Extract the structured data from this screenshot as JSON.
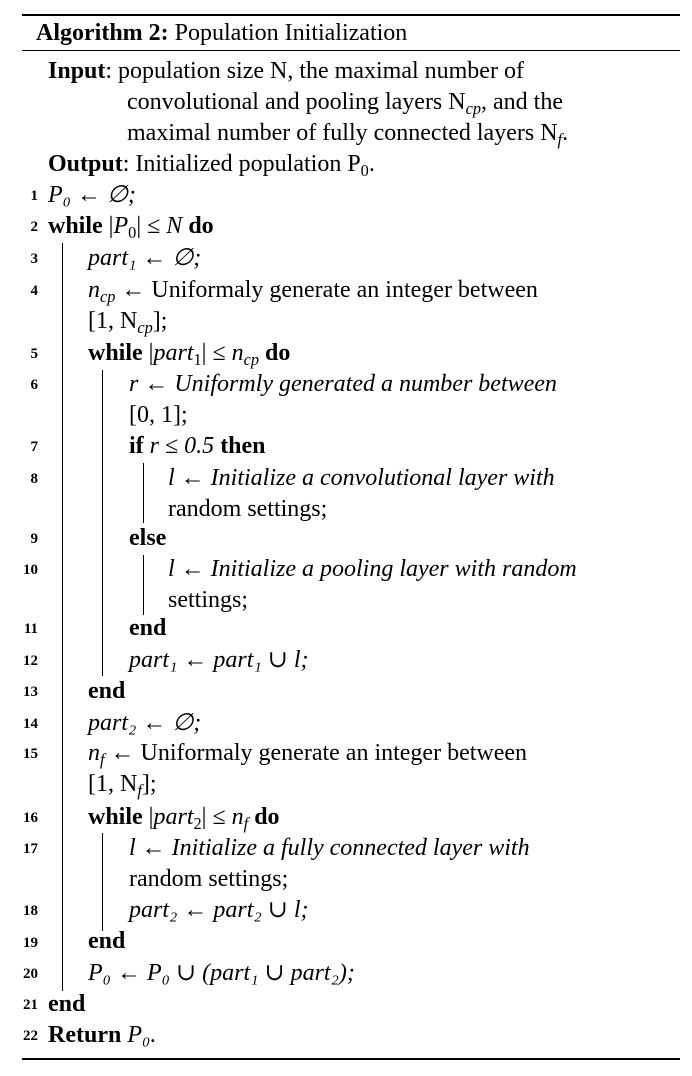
{
  "algorithm": {
    "label": "Algorithm 2:",
    "title": "Population Initialization"
  },
  "input": {
    "label": "Input",
    "line1": ": population size N, the maximal number of",
    "line2": "convolutional and pooling layers N",
    "line2_sub": "cp",
    "line2_end": ", and the",
    "line3": "maximal number of fully connected layers N",
    "line3_sub": "f",
    "line3_end": "."
  },
  "output": {
    "label": "Output",
    "text": ": Initialized population P",
    "sub": "0",
    "end": "."
  },
  "line_numbers": [
    "1",
    "2",
    "3",
    "4",
    "5",
    "6",
    "7",
    "8",
    "9",
    "10",
    "11",
    "12",
    "13",
    "14",
    "15",
    "16",
    "17",
    "18",
    "19",
    "20",
    "21",
    "22"
  ],
  "keywords": {
    "while": "while",
    "do": "do",
    "if": "if",
    "then": "then",
    "else": "else",
    "end": "end",
    "return": "Return"
  },
  "lines": {
    "l1": "P₀ ← ∅;",
    "l3": "part₁ ← ∅;",
    "l4a": "n",
    "l4a_sub": "cp",
    "l4b": " ← Uniformaly generate an integer between",
    "l4c": "[1, N",
    "l4c_sub": "cp",
    "l4c_end": "];",
    "l6a": "r ← Uniformly generated a number between",
    "l6b": "[0, 1];",
    "l7_cond": " r ≤ 0.5 ",
    "l8a": "l ← Initialize a convolutional layer with",
    "l8b": "random settings;",
    "l10a": "l ← Initialize a pooling layer with random",
    "l10b": "settings;",
    "l12": "part₁ ← part₁ ∪ l;",
    "l14": "part₂ ← ∅;",
    "l15a": "n",
    "l15a_sub": "f",
    "l15b": " ← Uniformaly generate an integer between",
    "l15c": "[1, N",
    "l15c_sub": "f",
    "l15c_end": "];",
    "l17a": "l ← Initialize a fully connected layer with",
    "l17b": "random settings;",
    "l18": "part₂ ← part₂ ∪ l;",
    "l20": "P₀ ← P₀ ∪ (part₁ ∪ part₂);",
    "l22": " P₀."
  }
}
